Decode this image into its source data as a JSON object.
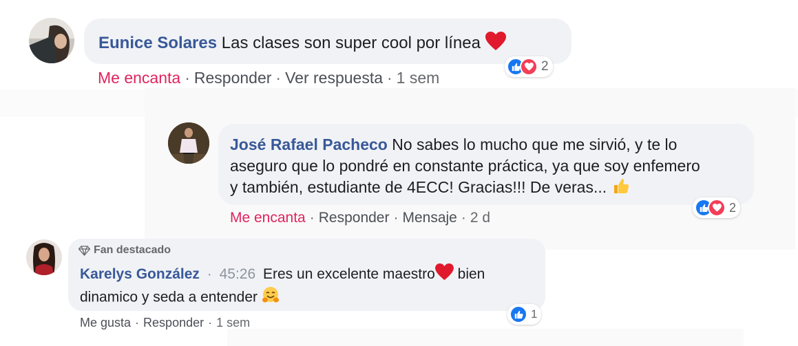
{
  "comments": [
    {
      "author": "Eunice Solares",
      "text": "Las clases son super cool por línea",
      "actions": [
        "Me encanta",
        "Responder",
        "Ver respuesta"
      ],
      "time": "1 sem",
      "reaction_count": "2",
      "reaction_icons": [
        "like-icon",
        "love-icon"
      ]
    },
    {
      "author": "José Rafael Pacheco",
      "text_line1": "No sabes lo mucho que me sirvió, y te lo",
      "text_line2": "aseguro que lo pondré en constante práctica, ya que soy enfemero",
      "text_line3": "y también, estudiante de 4ECC! Gracias!!! De veras...",
      "actions": [
        "Me encanta",
        "Responder",
        "Mensaje"
      ],
      "time": "2 d",
      "reaction_count": "2",
      "reaction_icons": [
        "like-icon",
        "love-icon"
      ]
    },
    {
      "badge": "Fan destacado",
      "author": "Karelys González",
      "timestamp": "45:26",
      "text_line1": "Eres un excelente maestro",
      "text_line1b": "bien",
      "text_line2": "dinamico y seda a entender",
      "actions": [
        "Me gusta",
        "Responder"
      ],
      "time": "1 sem",
      "reaction_count": "1",
      "reaction_icons": [
        "like-icon"
      ]
    }
  ],
  "colors": {
    "bubble": "#f0f2f5",
    "author": "#385898",
    "love_action": "#e0245e",
    "like_blue": "#1877f2",
    "love_red": "#f33e58"
  }
}
